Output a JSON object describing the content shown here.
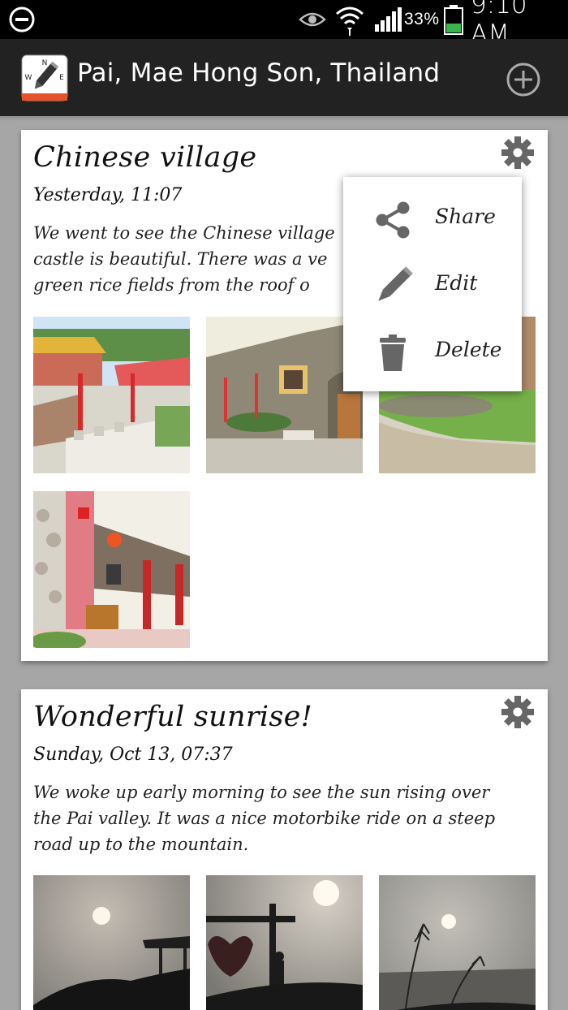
{
  "status_bar": {
    "battery_percent": "33%",
    "time": "9:10 AM",
    "icons": [
      "do-not-disturb-icon",
      "eye-icon",
      "wifi-icon",
      "signal-icon",
      "battery-icon"
    ]
  },
  "action_bar": {
    "title": "Pai, Mae Hong Son, Thailand",
    "app_icon": "compass-pencil-icon",
    "add_icon": "add-circle-icon"
  },
  "entries": [
    {
      "title": "Chinese village",
      "date": "Yesterday, 11:07",
      "body": "We went to see the Chinese village castle is beautiful. There was a ve green rice fields from the roof o",
      "body_lines": [
        "We went to see the Chinese village",
        "castle is beautiful. There was a ve",
        "green rice fields from the roof o"
      ],
      "photo_count": 4
    },
    {
      "title": "Wonderful sunrise!",
      "date": "Sunday, Oct 13, 07:37",
      "body_lines": [
        "We woke up early morning to see the sun rising over",
        "the Pai valley. It was a nice motorbike ride on a steep",
        "road up to the mountain."
      ],
      "photo_count": 3
    }
  ],
  "popup_menu": {
    "items": [
      {
        "label": "Share",
        "icon": "share-icon"
      },
      {
        "label": "Edit",
        "icon": "pencil-icon"
      },
      {
        "label": "Delete",
        "icon": "trash-icon"
      }
    ]
  },
  "colors": {
    "background": "#a6a6a6",
    "action_bar": "#222222",
    "status_bar": "#000000",
    "battery_green": "#39b54a",
    "icon_gray": "#666666"
  }
}
